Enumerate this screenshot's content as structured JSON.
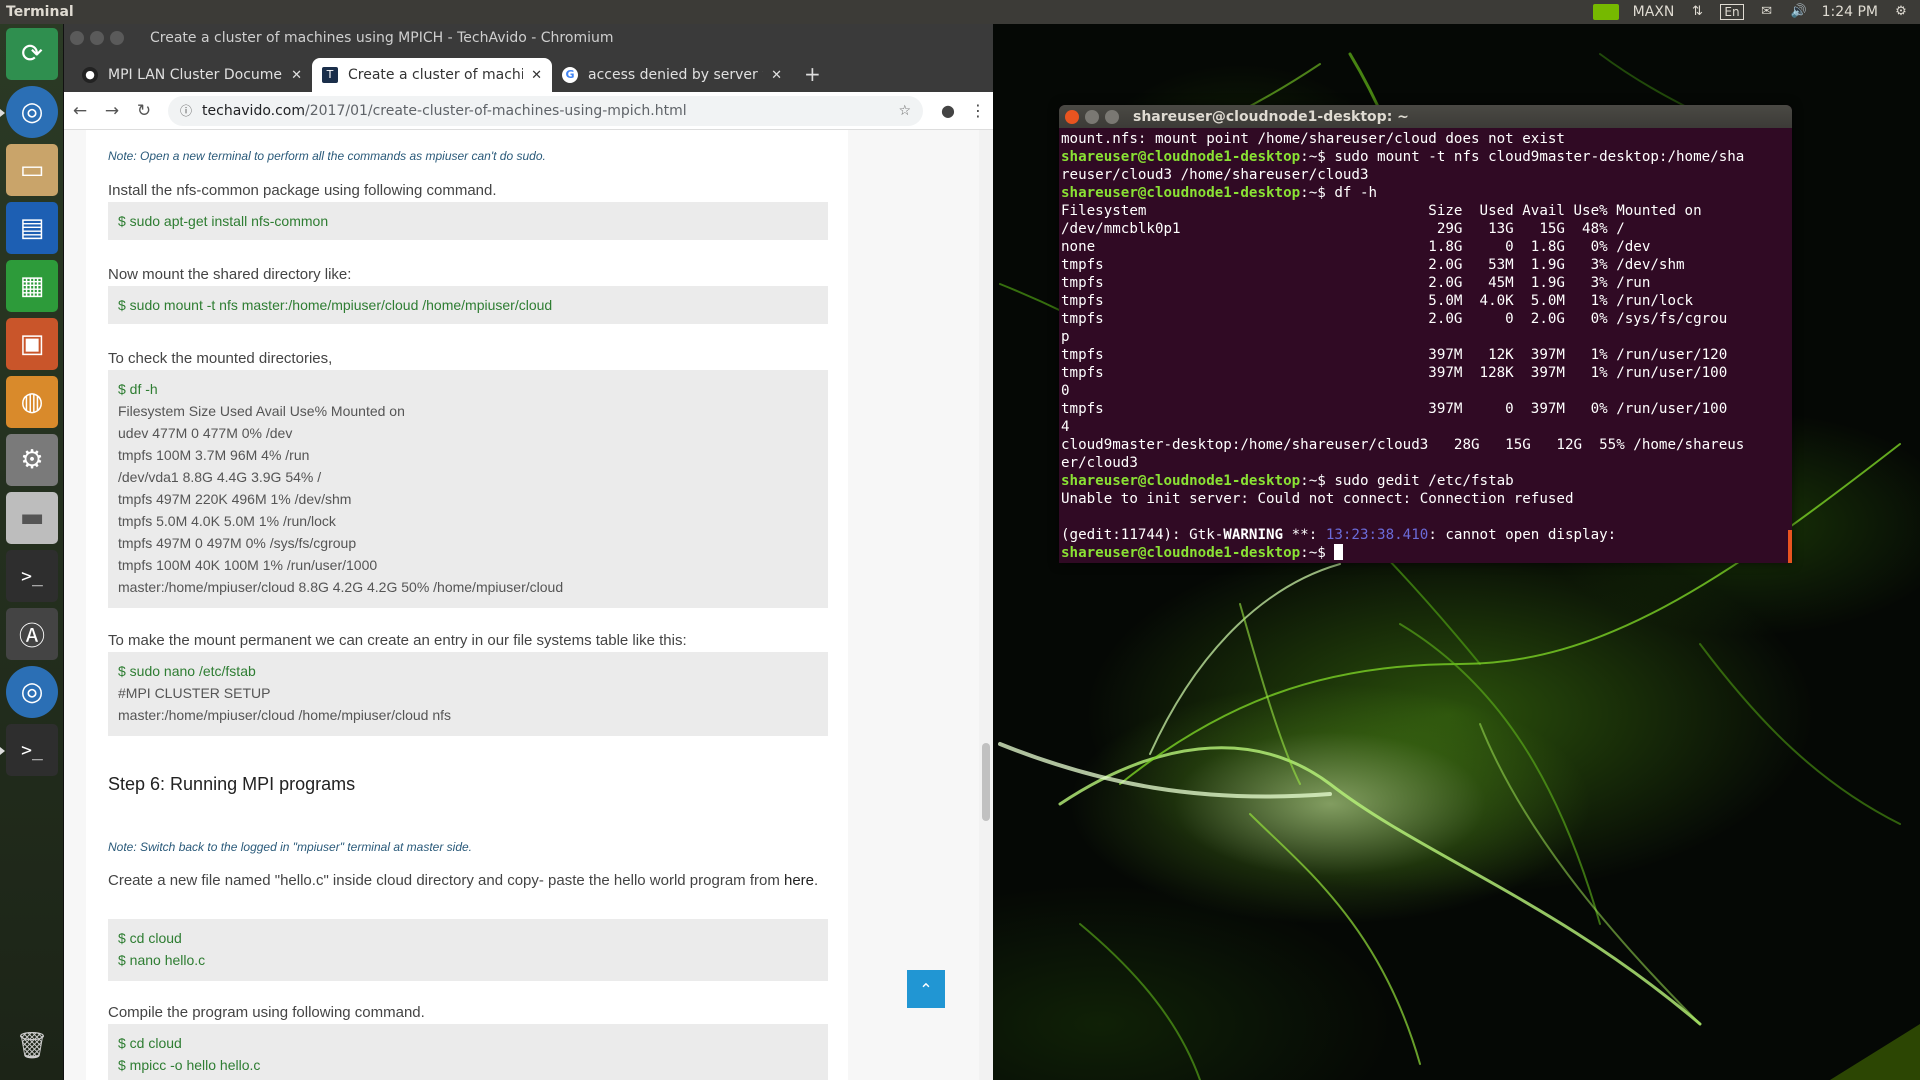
{
  "top_panel": {
    "app_title": "Terminal",
    "power_mode": "MAXN",
    "keyboard_layout": "En",
    "clock": "1:24 PM"
  },
  "launcher": {
    "items": [
      "ubuntu-software-updater",
      "chromium",
      "files",
      "writer",
      "calc",
      "impress",
      "software-center",
      "system-settings",
      "disk",
      "terminal",
      "software-updater",
      "chromium",
      "terminal",
      "trash"
    ]
  },
  "chromium": {
    "window_title": "Create a cluster of machines using MPICH - TechAvido - Chromium",
    "tabs": [
      {
        "label": "MPI LAN Cluster Docume"
      },
      {
        "label": "Create a cluster of machin"
      },
      {
        "label": "access denied by server w"
      }
    ],
    "new_tab": "+",
    "url_host": "techavido.com",
    "url_path": "/2017/01/create-cluster-of-machines-using-mpich.html",
    "article": {
      "note1": "Note: Open a new terminal to perform all the commands as mpiuser can't do sudo.",
      "p_install": "Install the nfs-common package using following command.",
      "c_install": "$ sudo apt-get install nfs-common",
      "p_mount": "Now mount the shared directory like:",
      "c_mount": "$ sudo mount -t nfs master:/home/mpiuser/cloud /home/mpiuser/cloud",
      "p_check": "To check the mounted directories,",
      "c_df_cmd": "$ df -h",
      "c_df_lines": [
        "Filesystem Size Used Avail Use% Mounted on",
        "udev 477M 0 477M 0% /dev",
        "tmpfs 100M 3.7M 96M 4% /run",
        "/dev/vda1 8.8G 4.4G 3.9G 54% /",
        "tmpfs 497M 220K 496M 1% /dev/shm",
        "tmpfs 5.0M 4.0K 5.0M 1% /run/lock",
        "tmpfs 497M 0 497M 0% /sys/fs/cgroup",
        "tmpfs 100M 40K 100M 1% /run/user/1000",
        "master:/home/mpiuser/cloud 8.8G 4.2G 4.2G 50% /home/mpiuser/cloud"
      ],
      "p_perm": "To make the mount permanent we can create an entry in our file systems table like this:",
      "c_fstab_cmd": "$ sudo nano /etc/fstab",
      "c_fstab_lines": [
        "#MPI CLUSTER SETUP",
        "master:/home/mpiuser/cloud /home/mpiuser/cloud nfs"
      ],
      "step6": "Step 6: Running MPI programs",
      "note2": "Note: Switch back to the logged in \"mpiuser\" terminal at master side.",
      "p_hello": "Create a new file named \"hello.c\" inside cloud directory and copy- paste the hello world program from",
      "p_hello_link": "here",
      "c_hello_lines": [
        "$ cd cloud",
        "$ nano hello.c"
      ],
      "p_compile": "Compile the program using following command.",
      "c_compile_lines": [
        "$ cd cloud",
        "$ mpicc -o hello hello.c"
      ]
    }
  },
  "terminal": {
    "title": "shareuser@cloudnode1-desktop: ~",
    "prompt": "shareuser@cloudnode1-desktop",
    "lines": [
      {
        "type": "out",
        "text": "mount.nfs: mount point /home/shareuser/cloud does not exist"
      },
      {
        "type": "cmd",
        "text": "sudo mount -t nfs cloud9master-desktop:/home/sha"
      },
      {
        "type": "out",
        "text": "reuser/cloud3 /home/shareuser/cloud3"
      },
      {
        "type": "cmd",
        "text": "df -h"
      },
      {
        "type": "out",
        "text": "Filesystem                                 Size  Used Avail Use% Mounted on"
      },
      {
        "type": "out",
        "text": "/dev/mmcblk0p1                              29G   13G   15G  48% /"
      },
      {
        "type": "out",
        "text": "none                                       1.8G     0  1.8G   0% /dev"
      },
      {
        "type": "out",
        "text": "tmpfs                                      2.0G   53M  1.9G   3% /dev/shm"
      },
      {
        "type": "out",
        "text": "tmpfs                                      2.0G   45M  1.9G   3% /run"
      },
      {
        "type": "out",
        "text": "tmpfs                                      5.0M  4.0K  5.0M   1% /run/lock"
      },
      {
        "type": "out",
        "text": "tmpfs                                      2.0G     0  2.0G   0% /sys/fs/cgrou"
      },
      {
        "type": "out",
        "text": "p"
      },
      {
        "type": "out",
        "text": "tmpfs                                      397M   12K  397M   1% /run/user/120"
      },
      {
        "type": "out",
        "text": "tmpfs                                      397M  128K  397M   1% /run/user/100"
      },
      {
        "type": "out",
        "text": "0"
      },
      {
        "type": "out",
        "text": "tmpfs                                      397M     0  397M   0% /run/user/100"
      },
      {
        "type": "out",
        "text": "4"
      },
      {
        "type": "out",
        "text": "cloud9master-desktop:/home/shareuser/cloud3   28G   15G   12G  55% /home/shareus"
      },
      {
        "type": "out",
        "text": "er/cloud3"
      },
      {
        "type": "cmd",
        "text": "sudo gedit /etc/fstab"
      },
      {
        "type": "out",
        "text": "Unable to init server: Could not connect: Connection refused"
      },
      {
        "type": "out",
        "text": ""
      },
      {
        "type": "warn",
        "pre": "(gedit:11744): Gtk-",
        "bold": "WARNING",
        "mid": " **: ",
        "ts": "13:23:38.410",
        "post": ": cannot open display:"
      },
      {
        "type": "prompt_only",
        "text": ""
      }
    ]
  }
}
